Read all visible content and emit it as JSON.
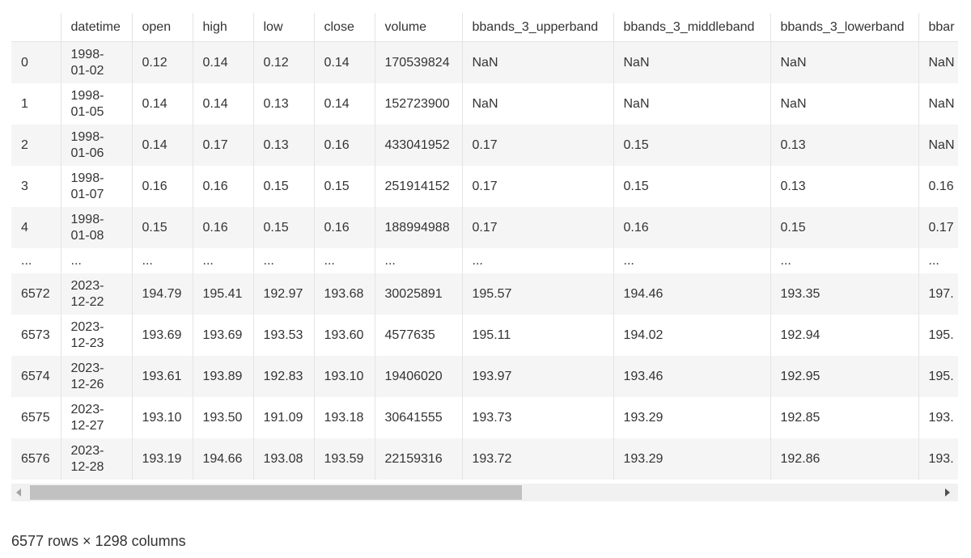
{
  "table": {
    "columns": [
      "",
      "datetime",
      "open",
      "high",
      "low",
      "close",
      "volume",
      "bbands_3_upperband",
      "bbands_3_middleband",
      "bbands_3_lowerband",
      "bbar"
    ],
    "rows": [
      [
        "0",
        "1998-01-02",
        "0.12",
        "0.14",
        "0.12",
        "0.14",
        "170539824",
        "NaN",
        "NaN",
        "NaN",
        "NaN"
      ],
      [
        "1",
        "1998-01-05",
        "0.14",
        "0.14",
        "0.13",
        "0.14",
        "152723900",
        "NaN",
        "NaN",
        "NaN",
        "NaN"
      ],
      [
        "2",
        "1998-01-06",
        "0.14",
        "0.17",
        "0.13",
        "0.16",
        "433041952",
        "0.17",
        "0.15",
        "0.13",
        "NaN"
      ],
      [
        "3",
        "1998-01-07",
        "0.16",
        "0.16",
        "0.15",
        "0.15",
        "251914152",
        "0.17",
        "0.15",
        "0.13",
        "0.16"
      ],
      [
        "4",
        "1998-01-08",
        "0.15",
        "0.16",
        "0.15",
        "0.16",
        "188994988",
        "0.17",
        "0.16",
        "0.15",
        "0.17"
      ],
      [
        "...",
        "...",
        "...",
        "...",
        "...",
        "...",
        "...",
        "...",
        "...",
        "...",
        "..."
      ],
      [
        "6572",
        "2023-12-22",
        "194.79",
        "195.41",
        "192.97",
        "193.68",
        "30025891",
        "195.57",
        "194.46",
        "193.35",
        "197."
      ],
      [
        "6573",
        "2023-12-23",
        "193.69",
        "193.69",
        "193.53",
        "193.60",
        "4577635",
        "195.11",
        "194.02",
        "192.94",
        "195."
      ],
      [
        "6574",
        "2023-12-26",
        "193.61",
        "193.89",
        "192.83",
        "193.10",
        "19406020",
        "193.97",
        "193.46",
        "192.95",
        "195."
      ],
      [
        "6575",
        "2023-12-27",
        "193.10",
        "193.50",
        "191.09",
        "193.18",
        "30641555",
        "193.73",
        "193.29",
        "192.85",
        "193."
      ],
      [
        "6576",
        "2023-12-28",
        "193.19",
        "194.66",
        "193.08",
        "193.59",
        "22159316",
        "193.72",
        "193.29",
        "192.86",
        "193."
      ]
    ]
  },
  "footer": {
    "shape_text": "6577 rows × 1298 columns"
  },
  "colors": {
    "odd_row_bg": "#f5f5f5",
    "even_row_bg": "#ffffff",
    "scroll_track": "#f1f1f1",
    "scroll_thumb": "#c1c1c1",
    "text": "#333333"
  },
  "icons": {
    "scroll_left": "scroll-left-arrow-icon",
    "scroll_right": "scroll-right-arrow-icon"
  }
}
